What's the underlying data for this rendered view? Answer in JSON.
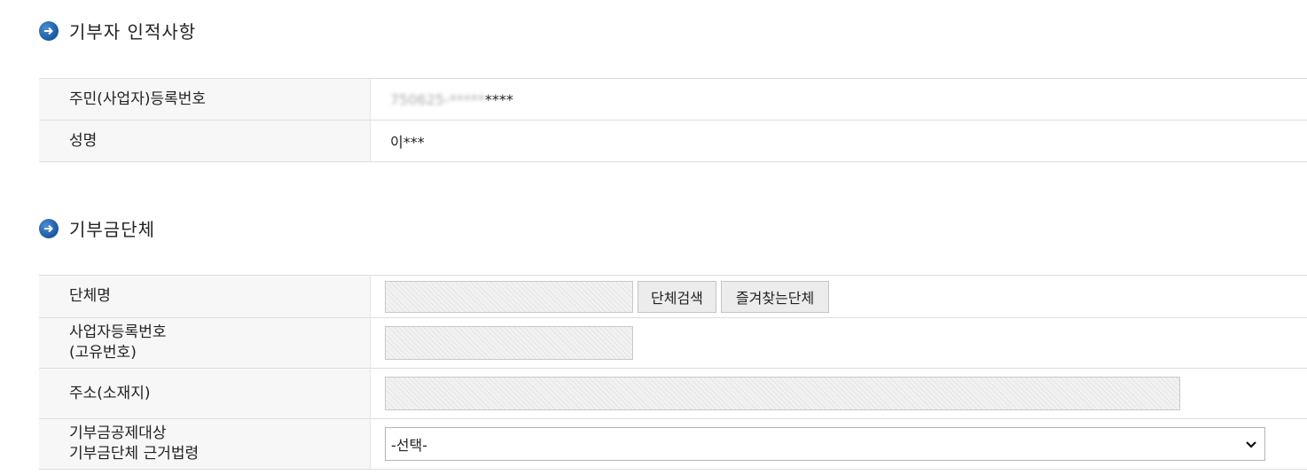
{
  "donor_section": {
    "title": "기부자 인적사항",
    "fields": {
      "reg_number_label": "주민(사업자)등록번호",
      "reg_number_masked_prefix": "750625-*****",
      "reg_number_suffix": "****",
      "name_label": "성명",
      "name_value": "이***"
    }
  },
  "org_section": {
    "title": "기부금단체",
    "fields": {
      "org_name_label": "단체명",
      "org_search_button": "단체검색",
      "favorite_org_button": "즐겨찾는단체",
      "biz_number_label_line1": "사업자등록번호",
      "biz_number_label_line2": "(고유번호)",
      "address_label": "주소(소재지)",
      "legal_basis_label_line1": "기부금공제대상",
      "legal_basis_label_line2": "기부금단체 근거법령",
      "legal_basis_select_value": "-선택-"
    }
  },
  "icons": {
    "bullet": "arrow-right-circle-icon",
    "select_arrow": "chevron-down-icon"
  },
  "colors": {
    "bullet_blue": "#1f5fa6",
    "label_bg": "#f7f7f7"
  }
}
